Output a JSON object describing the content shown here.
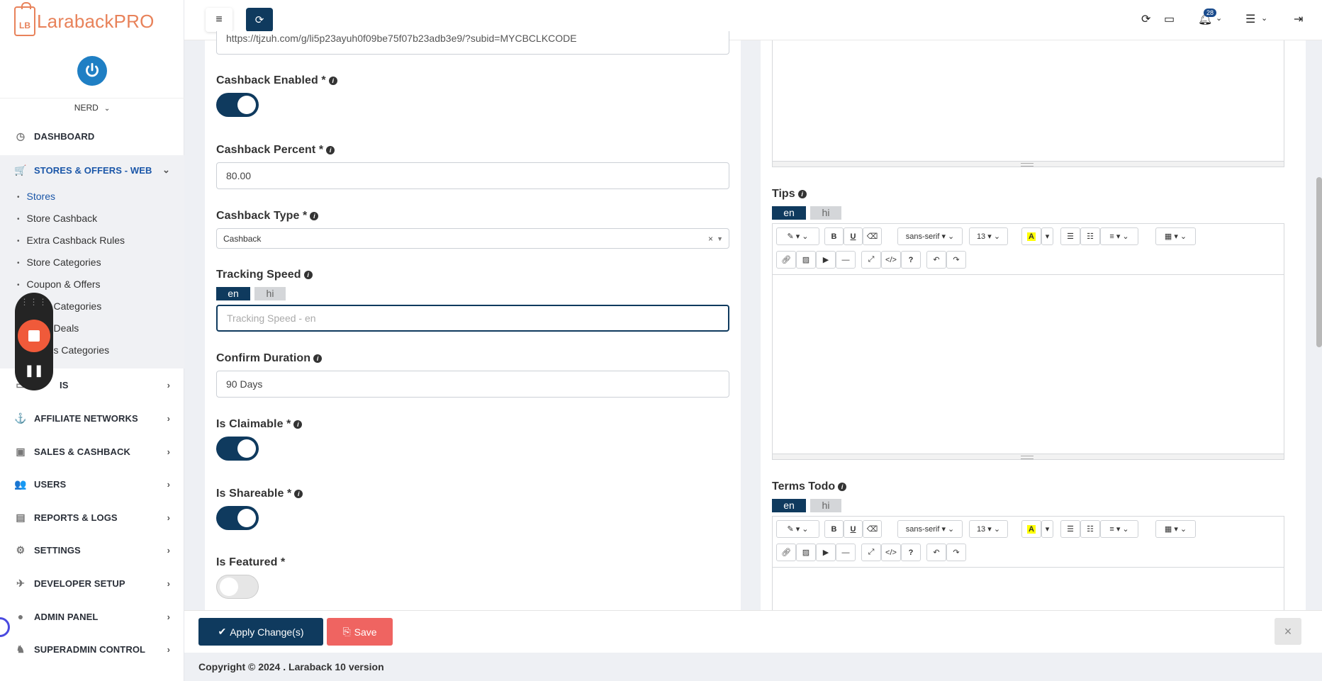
{
  "brand": {
    "logo_badge": "LB",
    "name": "LarabackPRO"
  },
  "user": {
    "name": "NERD"
  },
  "sidebar": {
    "items": [
      {
        "label": "DASHBOARD"
      },
      {
        "label": "STORES & OFFERS - WEB"
      },
      {
        "label": "IS"
      },
      {
        "label": "AFFILIATE NETWORKS"
      },
      {
        "label": "SALES & CASHBACK"
      },
      {
        "label": "USERS"
      },
      {
        "label": "REPORTS & LOGS"
      },
      {
        "label": "SETTINGS"
      },
      {
        "label": "DEVELOPER SETUP"
      },
      {
        "label": "ADMIN PANEL"
      },
      {
        "label": "SUPERADMIN CONTROL"
      }
    ],
    "submenu": [
      "Stores",
      "Store Cashback",
      "Extra Cashback Rules",
      "Store Categories",
      "Coupon & Offers",
      "Categories",
      "Deals",
      "s Categories"
    ]
  },
  "topbar": {
    "notification_count": "28"
  },
  "form": {
    "url_value": "https://tjzuh.com/g/li5p23ayuh0f09be75f07b23adb3e9/?subid=MYCBCLKCODE",
    "cashback_enabled": {
      "label": "Cashback Enabled *",
      "on": true
    },
    "cashback_percent": {
      "label": "Cashback Percent *",
      "value": "80.00"
    },
    "cashback_type": {
      "label": "Cashback Type *",
      "value": "Cashback",
      "clear": "×"
    },
    "tracking_speed": {
      "label": "Tracking Speed",
      "placeholder": "Tracking Speed - en"
    },
    "confirm_duration": {
      "label": "Confirm Duration",
      "value": "90 Days"
    },
    "is_claimable": {
      "label": "Is Claimable *",
      "on": true
    },
    "is_shareable": {
      "label": "Is Shareable *",
      "on": true
    },
    "is_featured": {
      "label": "Is Featured *",
      "on": false
    }
  },
  "lang_tabs": [
    "en",
    "hi"
  ],
  "right": {
    "tips_label": "Tips",
    "terms_label": "Terms Todo",
    "toolbar": {
      "font": "sans-serif",
      "size": "13",
      "bold": "B",
      "underline": "U",
      "help": "?",
      "code": "</>"
    }
  },
  "buttons": {
    "apply": "Apply Change(s)",
    "save": "Save",
    "close": "×"
  },
  "footer": {
    "prefix": "Copyright © 2024 . ",
    "brand": "Laraback 10 version"
  },
  "colors": {
    "primary": "#0f3a5e",
    "accent": "#e8825a",
    "danger": "#ef6461",
    "link": "#1a56a8"
  }
}
